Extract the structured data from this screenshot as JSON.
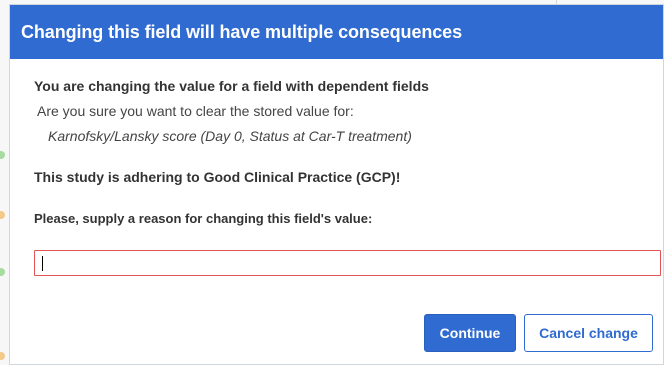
{
  "dialog": {
    "title": "Changing this field will have multiple consequences",
    "warning_heading": "You are changing the value for a field with dependent fields",
    "question": "Are you sure you want to clear the stored value for:",
    "field_reference": "Karnofsky/Lansky score (Day 0, Status at Car-T treatment)",
    "gcp_notice": "This study is adhering to Good Clinical Practice (GCP)!",
    "reason_label": "Please, supply a reason for changing this field's value:",
    "reason_value": "",
    "continue_label": "Continue",
    "cancel_label": "Cancel change"
  },
  "colors": {
    "accent": "#2f6bd1",
    "input_error_border": "#e05555"
  }
}
